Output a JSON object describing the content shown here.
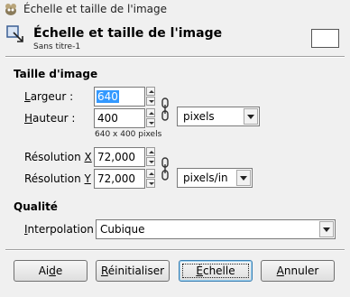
{
  "window": {
    "title": "Échelle et taille de l'image"
  },
  "header": {
    "title": "Échelle et taille de l'image",
    "subtitle": "Sans titre-1"
  },
  "image_size": {
    "section": "Taille d'image",
    "width_label_pre": "L",
    "width_label_post": "argeur :",
    "width_value": "640",
    "height_label_pre": "H",
    "height_label_post": "auteur :",
    "height_value": "400",
    "size_note": "640 x 400 pixels",
    "unit": "pixels",
    "res_x_label_pre": "Résolution ",
    "res_x_label_u": "X",
    "res_x_label_post": " :",
    "res_x_value": "72,000",
    "res_y_label_pre": "Résolution ",
    "res_y_label_u": "Y",
    "res_y_label_post": " :",
    "res_y_value": "72,000",
    "res_unit": "pixels/in"
  },
  "quality": {
    "section": "Qualité",
    "interp_label_pre": "I",
    "interp_label_post": "nterpolation :",
    "interp_value": "Cubique"
  },
  "buttons": {
    "help_pre": "Ai",
    "help_u": "d",
    "help_post": "e",
    "reset_u": "R",
    "reset_post": "éinitialiser",
    "scale_u": "É",
    "scale_post": "chelle",
    "cancel_u": "A",
    "cancel_post": "nnuler"
  }
}
